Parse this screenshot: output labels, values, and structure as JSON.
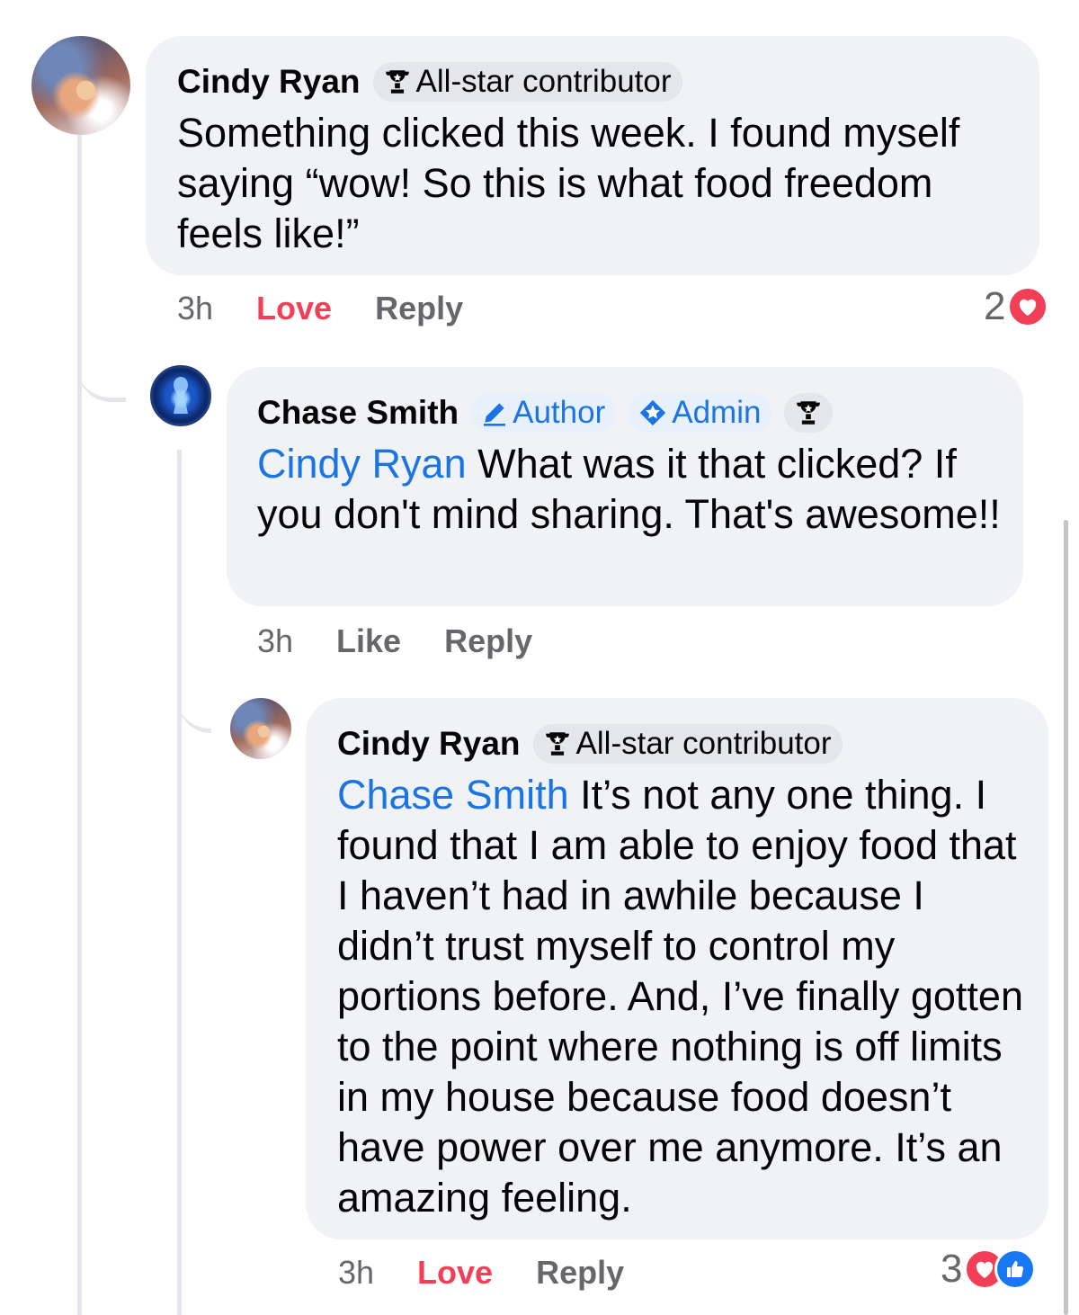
{
  "comments": [
    {
      "author": "Cindy Ryan",
      "badge": "All-star contributor",
      "text": "Something clicked this week. I found myself saying “wow! So this is what food freedom feels like!”",
      "time": "3h",
      "reaction_label": "Love",
      "reply_label": "Reply",
      "reaction_count": "2"
    },
    {
      "author": "Chase Smith",
      "badges": [
        "Author",
        "Admin"
      ],
      "mention": "Cindy Ryan",
      "text": " What was it that clicked? If you don't mind sharing. That's awesome!!",
      "time": "3h",
      "reaction_label": "Like",
      "reply_label": "Reply"
    },
    {
      "author": "Cindy Ryan",
      "badge": "All-star contributor",
      "mention": "Chase Smith",
      "text": " It’s not any one thing. I found that I am able to enjoy food that I haven’t had in awhile because I didn’t trust myself to control my portions before. And, I’ve finally gotten to the point where nothing is off limits in my house because food doesn’t have power over me anymore. It’s an amazing feeling.",
      "time": "3h",
      "reaction_label": "Love",
      "reply_label": "Reply",
      "reaction_count": "3"
    }
  ],
  "colors": {
    "love": "#f33e58",
    "link": "#1b74e4",
    "bubble": "#f0f2f5",
    "muted": "#65676b"
  },
  "icons": [
    "trophy-icon",
    "pencil-icon",
    "admin-shield-icon",
    "heart-reaction-icon",
    "like-reaction-icon"
  ]
}
